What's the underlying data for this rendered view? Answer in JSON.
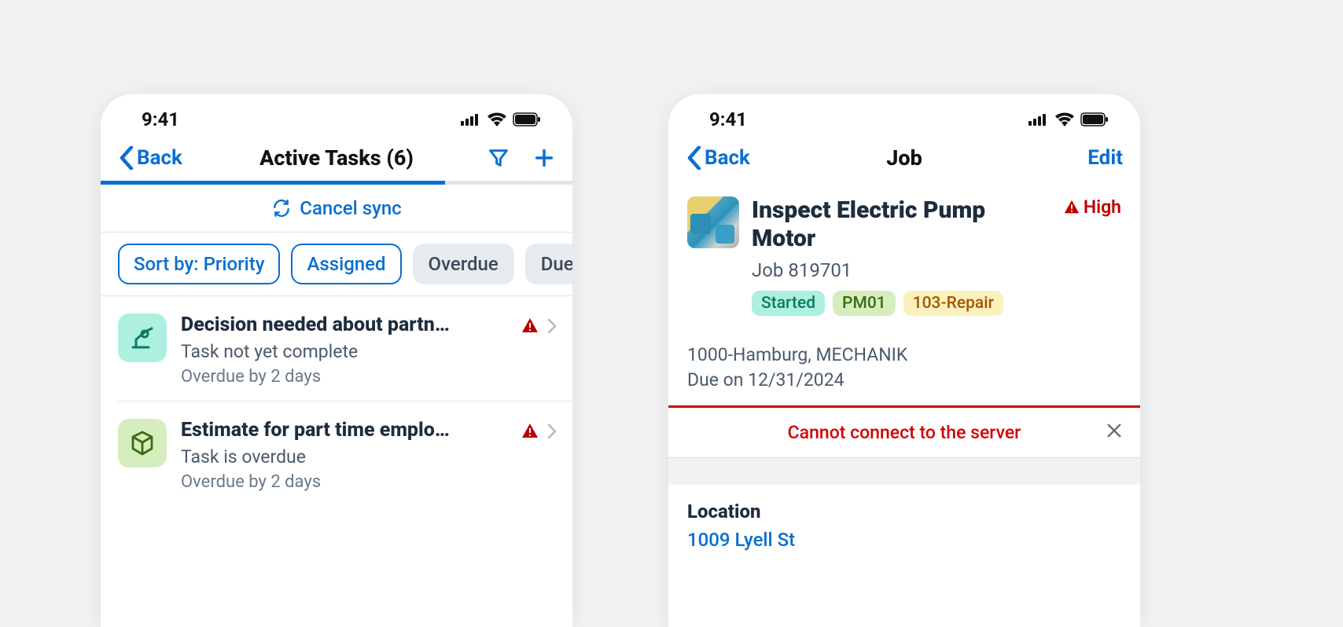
{
  "status_bar": {
    "time": "9:41"
  },
  "left": {
    "nav": {
      "back_label": "Back",
      "title": "Active Tasks (6)"
    },
    "sync": {
      "cancel_label": "Cancel sync"
    },
    "chips": {
      "sort": "Sort by: Priority",
      "assigned": "Assigned",
      "overdue": "Overdue",
      "due_today": "Due Today"
    },
    "items": [
      {
        "title": "Decision needed about partn…",
        "subtitle": "Task not yet complete",
        "meta": "Overdue by 2 days"
      },
      {
        "title": "Estimate for part time emplo…",
        "subtitle": "Task is overdue",
        "meta": "Overdue by 2 days"
      }
    ]
  },
  "right": {
    "nav": {
      "back_label": "Back",
      "title": "Job",
      "edit_label": "Edit"
    },
    "job": {
      "title": "Inspect Electric Pump Motor",
      "id_label": "Job 819701",
      "priority": "High",
      "tags": {
        "status": "Started",
        "code": "PM01",
        "type": "103-Repair"
      },
      "location_line": "1000-Hamburg, MECHANIK",
      "due_line": "Due on 12/31/2024"
    },
    "error": {
      "message": "Cannot connect to the server"
    },
    "section": {
      "location_label": "Location",
      "location_value": "1009 Lyell St"
    }
  }
}
